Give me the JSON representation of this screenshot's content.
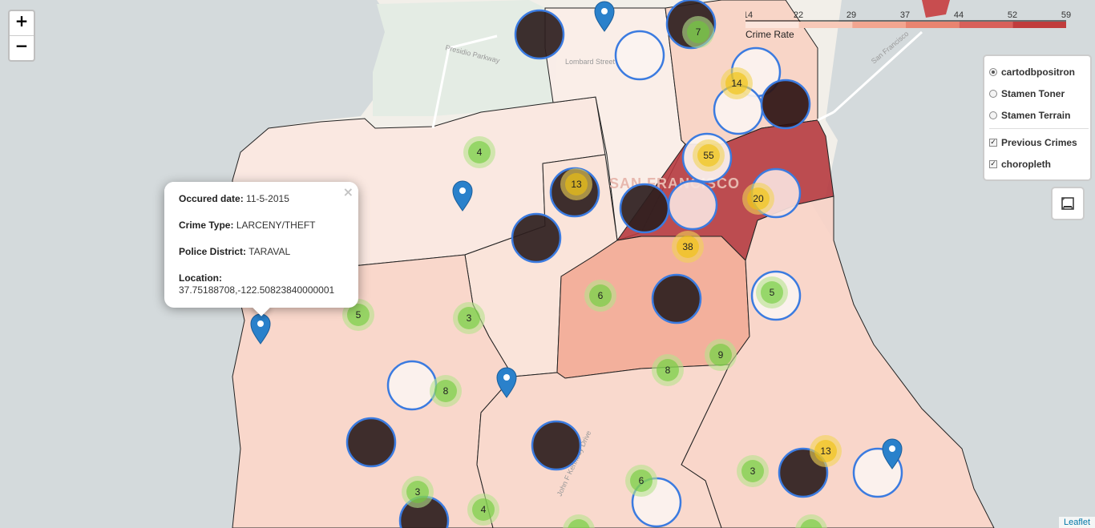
{
  "map": {
    "city_label": "SAN FRANCISCO",
    "street_labels": [
      "Presidio Parkway",
      "Lombard Street",
      "San Francisco",
      "John F Kennedy Drive"
    ],
    "colors": {
      "water": "#d4dadc",
      "land": "#f2efe9",
      "park": "#e4ece4",
      "marker_blue": "#2a81cb",
      "cluster_small": "#6ecc39",
      "cluster_medium": "#f1d357",
      "circle_dark": "#2e1e1e",
      "circle_light": "#f7e9e4"
    }
  },
  "zoom": {
    "in_label": "+",
    "out_label": "−"
  },
  "legend": {
    "title": "Crime Rate",
    "ticks": [
      "14",
      "22",
      "29",
      "37",
      "44",
      "52",
      "59"
    ],
    "colors": [
      "#fce5dc",
      "#f8c9b8",
      "#f2a590",
      "#e98470",
      "#d8605a",
      "#c03c3c"
    ]
  },
  "layers": {
    "base": [
      {
        "label": "cartodbpositron",
        "selected": true
      },
      {
        "label": "Stamen Toner",
        "selected": false
      },
      {
        "label": "Stamen Terrain",
        "selected": false
      }
    ],
    "overlays": [
      {
        "label": "Previous Crimes",
        "checked": true
      },
      {
        "label": "choropleth",
        "checked": true
      }
    ]
  },
  "fullscreen_icon": "fullscreen-icon",
  "popup": {
    "date_label": "Occured date:",
    "date_value": "11-5-2015",
    "type_label": "Crime Type:",
    "type_value": "LARCENY/THEFT",
    "district_label": "Police District:",
    "district_value": "TARAVAL",
    "location_label": "Location:",
    "location_value": "37.75188708,-122.50823840000001",
    "close": "×"
  },
  "clusters": [
    "7",
    "14",
    "4",
    "13",
    "55",
    "20",
    "38",
    "5",
    "6",
    "9",
    "5",
    "3",
    "8",
    "8",
    "3",
    "6",
    "13",
    "3",
    "4"
  ],
  "attribution": "Leaflet"
}
